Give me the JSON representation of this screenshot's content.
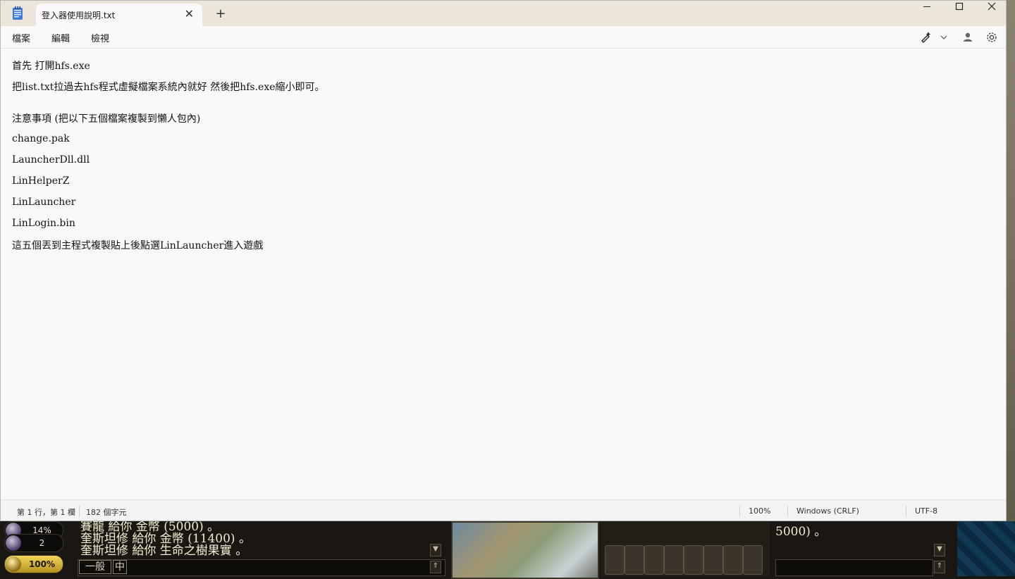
{
  "window": {
    "tab_title": "登入器使用說明.txt",
    "tab_close_glyph": "✕",
    "tab_add_glyph": "+",
    "minimize_glyph": "—",
    "maximize_glyph": "☐",
    "close_glyph": "✕"
  },
  "menu": {
    "file": "檔案",
    "edit": "編輯",
    "view": "檢視"
  },
  "toolbar_icons": [
    "copilot-icon",
    "chevron-down-icon",
    "account-icon",
    "gear-icon"
  ],
  "editor": {
    "lines": [
      "首先 打開hfs.exe",
      "把list.txt拉過去hfs程式虛擬檔案系統內就好 然後把hfs.exe縮小即可。",
      "注意事項 (把以下五個檔案複製到懶人包內)",
      "change.pak",
      "LauncherDll.dll",
      "LinHelperZ",
      "LinLauncher",
      "LinLogin.bin",
      "這五個丟到主程式複製貼上後點選LinLauncher進入遊戲"
    ]
  },
  "status": {
    "position": "第 1 行，第 1 欄",
    "char_count": "182 個字元",
    "zoom": "100%",
    "line_ending": "Windows (CRLF)",
    "encoding": "UTF-8"
  },
  "game": {
    "stat_1": "14%",
    "stat_2": "2",
    "stat_3": "100%",
    "chat_lines": [
      "賽龍 給你 金幣 (5000) 。",
      "奎斯坦修 給你 金幣 (11400) 。",
      "奎斯坦修 給你 生命之樹果實 。"
    ],
    "chat_mode": "一般",
    "chat_lang": "中",
    "chat2_line": "5000) 。"
  },
  "colors": {
    "titlebar": "#ece5da",
    "editor_bg": "#f9f9f9",
    "gold": "#f4d65a"
  }
}
